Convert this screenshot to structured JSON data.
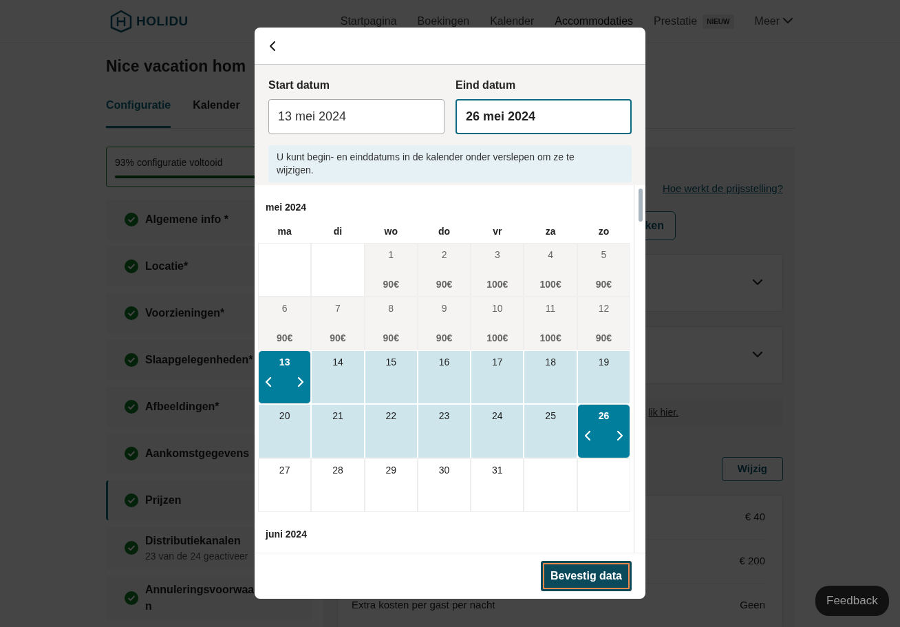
{
  "navbar": {
    "logo": "HOLIDU",
    "links": [
      {
        "label": "Startpagina",
        "selected": false
      },
      {
        "label": "Boekingen",
        "selected": false
      },
      {
        "label": "Kalender",
        "selected": false
      },
      {
        "label": "Accommodaties",
        "selected": true
      },
      {
        "label": "Prestatie",
        "badge": "NIEUW",
        "selected": false
      }
    ],
    "more": "Meer"
  },
  "page": {
    "title": "Nice vacation hom",
    "tabs": [
      {
        "label": "Configuratie",
        "selected": true
      },
      {
        "label": "Kalender",
        "selected": false
      }
    ],
    "progress": {
      "label": "93% configuratie voltooid",
      "level": 0.93
    },
    "sidebar": [
      {
        "label": "Algemene info *",
        "selected": false
      },
      {
        "label": "Locatie*",
        "selected": false
      },
      {
        "label": "Voorzieningen*",
        "selected": false
      },
      {
        "label": "Slaapgelegenheden*",
        "selected": false
      },
      {
        "label": "Afbeeldingen*",
        "selected": false
      },
      {
        "label": "Aankomstgegevens",
        "selected": false
      },
      {
        "label": "Prijzen",
        "selected": true
      },
      {
        "label": "Distributiekanalen",
        "sub": "23 van de 24 geactiveer",
        "selected": false
      },
      {
        "label": "Annuleringsvoorwaa n",
        "selected": false
      }
    ],
    "pricing": {
      "help_link": "Hoe werkt de prijsstelling?",
      "button": "ken",
      "info_link": "lik hier.",
      "edit_button": "Wijzig",
      "rows": [
        {
          "value": "€ 40"
        },
        {
          "value": "€ 200"
        },
        {
          "label": "Extra kosten per gast per nacht",
          "value": "Geen"
        }
      ]
    }
  },
  "modal": {
    "start_label": "Start datum",
    "start_value": "13 mei 2024",
    "end_label": "Eind datum",
    "end_value": "26 mei 2024",
    "hint": "U kunt begin- en einddatums in de kalender onder verslepen om ze te wijzigen.",
    "weekdays": [
      "ma",
      "di",
      "wo",
      "do",
      "vr",
      "za",
      "zo"
    ],
    "months": [
      {
        "title": "mei 2024",
        "weeks": [
          [
            {
              "kind": "blank"
            },
            {
              "kind": "blank"
            },
            {
              "kind": "past",
              "day": "1",
              "price": "90€"
            },
            {
              "kind": "past",
              "day": "2",
              "price": "90€"
            },
            {
              "kind": "past",
              "day": "3",
              "price": "100€"
            },
            {
              "kind": "past",
              "day": "4",
              "price": "100€"
            },
            {
              "kind": "past",
              "day": "5",
              "price": "90€"
            }
          ],
          [
            {
              "kind": "past",
              "day": "6",
              "price": "90€"
            },
            {
              "kind": "past",
              "day": "7",
              "price": "90€"
            },
            {
              "kind": "past",
              "day": "8",
              "price": "90€"
            },
            {
              "kind": "past",
              "day": "9",
              "price": "90€"
            },
            {
              "kind": "past",
              "day": "10",
              "price": "100€"
            },
            {
              "kind": "past",
              "day": "11",
              "price": "100€"
            },
            {
              "kind": "past",
              "day": "12",
              "price": "90€"
            }
          ],
          [
            {
              "kind": "endpoint",
              "day": "13"
            },
            {
              "kind": "range",
              "day": "14"
            },
            {
              "kind": "range",
              "day": "15"
            },
            {
              "kind": "range",
              "day": "16"
            },
            {
              "kind": "range",
              "day": "17"
            },
            {
              "kind": "range",
              "day": "18"
            },
            {
              "kind": "range",
              "day": "19"
            }
          ],
          [
            {
              "kind": "range",
              "day": "20"
            },
            {
              "kind": "range",
              "day": "21"
            },
            {
              "kind": "range",
              "day": "22"
            },
            {
              "kind": "range",
              "day": "23"
            },
            {
              "kind": "range",
              "day": "24"
            },
            {
              "kind": "range",
              "day": "25"
            },
            {
              "kind": "endpoint",
              "day": "26"
            }
          ],
          [
            {
              "kind": "open",
              "day": "27"
            },
            {
              "kind": "open",
              "day": "28"
            },
            {
              "kind": "open",
              "day": "29"
            },
            {
              "kind": "open",
              "day": "30"
            },
            {
              "kind": "open",
              "day": "31"
            },
            {
              "kind": "blank"
            },
            {
              "kind": "blank"
            }
          ]
        ]
      },
      {
        "title": "juni 2024"
      }
    ],
    "confirm": "Bevestig data"
  },
  "feedback": "Feedback"
}
